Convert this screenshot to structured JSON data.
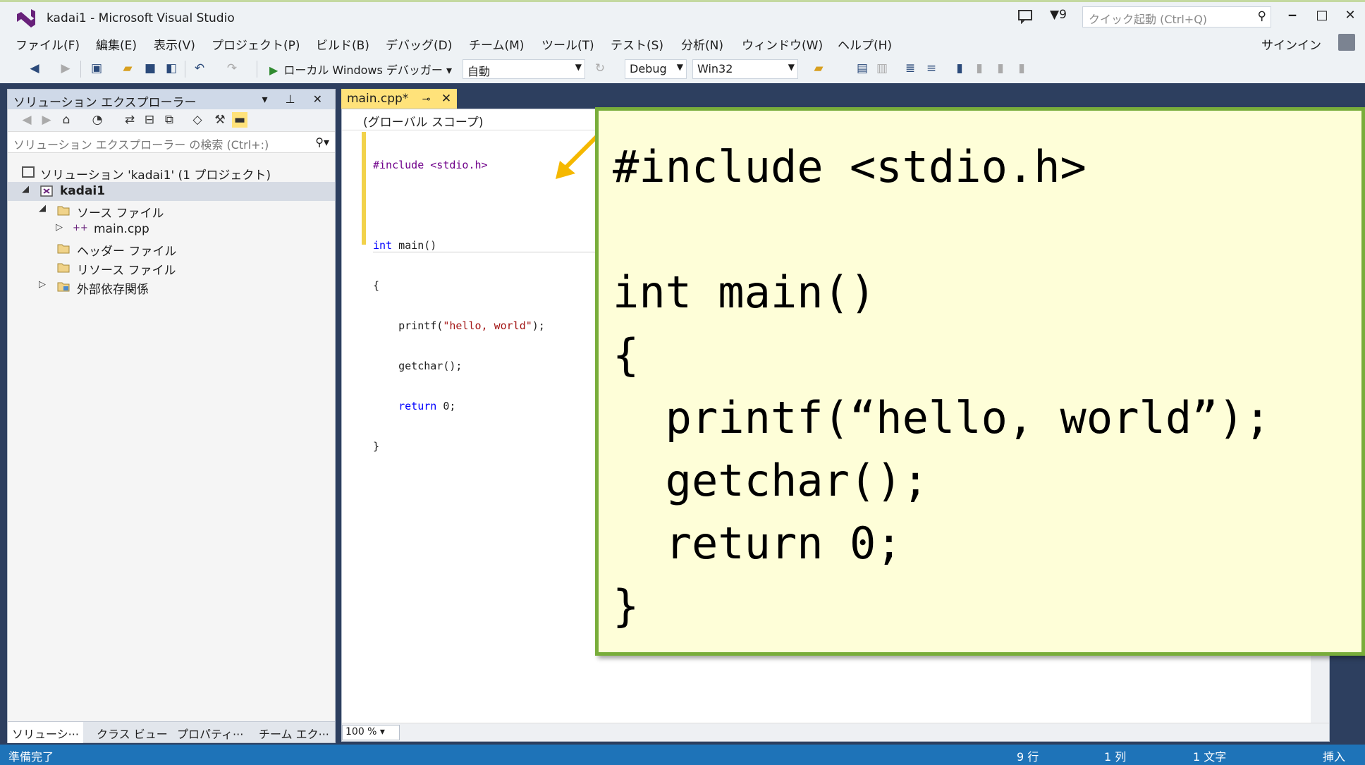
{
  "window": {
    "title": "kadai1 - Microsoft Visual Studio",
    "notification_count": "9",
    "quick_launch_placeholder": "クイック起動 (Ctrl+Q)",
    "minimize": "‒",
    "maximize": "□",
    "close": "✕"
  },
  "menu": {
    "items": [
      "ファイル(F)",
      "編集(E)",
      "表示(V)",
      "プロジェクト(P)",
      "ビルド(B)",
      "デバッグ(D)",
      "チーム(M)",
      "ツール(T)",
      "テスト(S)",
      "分析(N)",
      "ウィンドウ(W)",
      "ヘルプ(H)"
    ],
    "signin": "サインイン"
  },
  "toolbar": {
    "debugger_label": "ローカル Windows デバッガー",
    "solution_config": "自動",
    "build_config": "Debug",
    "platform": "Win32"
  },
  "solution_explorer": {
    "title": "ソリューション エクスプローラー",
    "search_placeholder": "ソリューション エクスプローラー の検索 (Ctrl+:)",
    "tree": {
      "solution": "ソリューション 'kadai1' (1 プロジェクト)",
      "project": "kadai1",
      "source_files": "ソース ファイル",
      "main_cpp": "main.cpp",
      "header_files": "ヘッダー ファイル",
      "resource_files": "リソース ファイル",
      "external_deps": "外部依存関係"
    },
    "tabs": [
      "ソリューシ···",
      "クラス ビュー",
      "プロパティ···",
      "チーム エク···"
    ]
  },
  "editor": {
    "tab_label": "main.cpp*",
    "scope": "(グローバル スコープ)",
    "zoom": "100 %",
    "code": {
      "l1_pp": "#include <stdio.h>",
      "l2_kw": "int",
      "l2_rest": " main()",
      "l3": "{",
      "l4_a": "    printf(",
      "l4_str": "\"hello, world\"",
      "l4_b": ");",
      "l5": "    getchar();",
      "l6_kw": "    return",
      "l6_rest": " 0;",
      "l7": "}"
    }
  },
  "callout": {
    "lines": [
      "#include <stdio.h>",
      "",
      "int main()",
      "{",
      "  printf(“hello, world”);",
      "  getchar();",
      "  return 0;",
      "}"
    ]
  },
  "status": {
    "ready": "準備完了",
    "line": "9 行",
    "col": "1 列",
    "char": "1 文字",
    "mode": "挿入"
  },
  "colors": {
    "statusbar": "#1e73b8",
    "callout_bg": "#fefed8",
    "callout_border": "#78ad3a",
    "arrow": "#f5b800"
  }
}
